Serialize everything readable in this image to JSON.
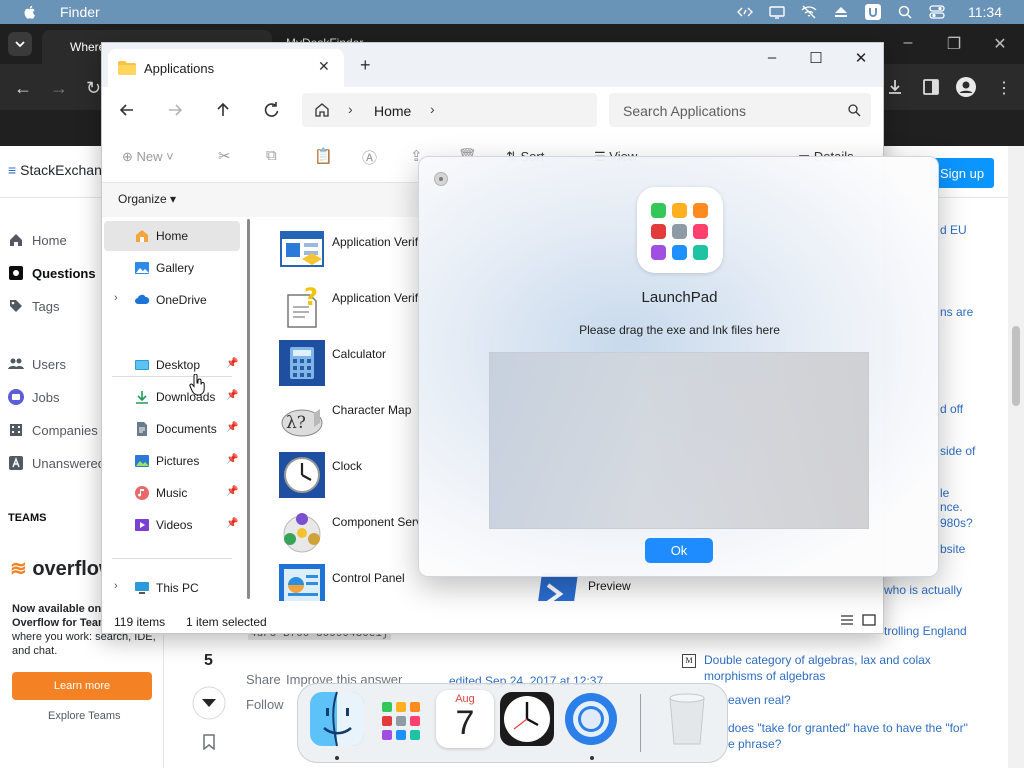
{
  "menubar": {
    "app_name": "Finder",
    "time": "11:34",
    "bg_color": "#6a93b8"
  },
  "browser": {
    "tab1_title": "Where is the Application\" Directory",
    "tab2_title": "MyDeskFinder"
  },
  "stackexchange": {
    "logo_text": "StackExchange",
    "signup_label": "Sign up",
    "nav": {
      "home": "Home",
      "questions": "Questions",
      "tags": "Tags",
      "users": "Users",
      "jobs": "Jobs",
      "companies": "Companies",
      "unanswered": "Unanswered"
    },
    "teams_header": "TEAMS",
    "overflow_brand_pre": "overflow",
    "promo_bold_line1": "Now available on Stack",
    "promo_bold_line2": "Overflow for Teams",
    "promo_text": "features where you work: search, IDE, and chat.",
    "learn_more": "Learn more",
    "explore_teams": "Explore Teams",
    "vote_count": "5",
    "share_link": "Share",
    "improve_link": "Improve this answer",
    "follow_link": "Follow",
    "edited_text": "edited Sep 24, 2017 at 12:37",
    "guid_fragment": "4dF5-B700-30999430e1}",
    "right_fragments": [
      "d EU",
      "ns are",
      "d off",
      "side of",
      "le",
      "nce.",
      "980s?",
      "bsite",
      "who is actually",
      "trolling England",
      "Double category of algebras, lax and colax morphisms of algebras",
      "eaven real?",
      "does \"take for granted\" have to have the \"for\"",
      "e phrase?"
    ]
  },
  "explorer": {
    "tab_title": "Applications",
    "breadcrumb": "Home",
    "search_placeholder": "Search Applications",
    "cmd_new": "New",
    "cmd_sort": "Sort",
    "cmd_view": "View",
    "cmd_details": "Details",
    "organize": "Organize",
    "sidebar": [
      {
        "label": "Home"
      },
      {
        "label": "Gallery"
      },
      {
        "label": "OneDrive"
      },
      {
        "label": "Desktop"
      },
      {
        "label": "Downloads"
      },
      {
        "label": "Documents"
      },
      {
        "label": "Pictures"
      },
      {
        "label": "Music"
      },
      {
        "label": "Videos"
      },
      {
        "label": "This PC"
      }
    ],
    "apps": [
      {
        "label": "Application Verif"
      },
      {
        "label": "Application Verif"
      },
      {
        "label": "Calculator"
      },
      {
        "label": "Character Map"
      },
      {
        "label": "Clock"
      },
      {
        "label": "Component Serv"
      },
      {
        "label": "Control Panel"
      },
      {
        "label": "Preview"
      }
    ],
    "status_count": "119 items",
    "status_selected": "1 item selected"
  },
  "launchpad": {
    "title": "LaunchPad",
    "instruction": "Please drag the exe and lnk files here",
    "ok_label": "Ok",
    "accent_color": "#1e8bff"
  },
  "dock": {
    "calendar_month": "Aug",
    "calendar_day": "7"
  }
}
